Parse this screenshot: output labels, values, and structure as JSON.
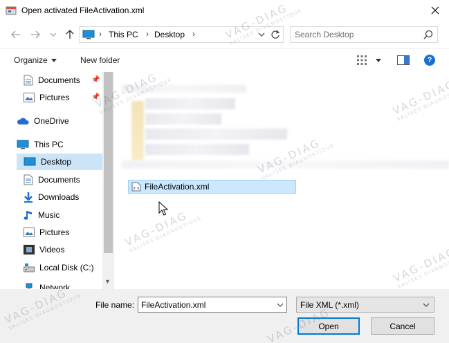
{
  "window": {
    "title": "Open activated FileActivation.xml",
    "close_label": "✕"
  },
  "navigation": {
    "back_label": "←",
    "forward_label": "→",
    "recent_label": "⌄",
    "up_label": "↑"
  },
  "address": {
    "crumbs": [
      "This PC",
      "Desktop"
    ],
    "separator": "›"
  },
  "search": {
    "placeholder": "Search Desktop"
  },
  "toolbar": {
    "organize_label": "Organize",
    "new_folder_label": "New folder",
    "help_label": "?"
  },
  "nav_pane": {
    "quick_access": [
      {
        "label": "Documents",
        "icon": "documents-icon",
        "pinned": true
      },
      {
        "label": "Pictures",
        "icon": "pictures-icon",
        "pinned": true
      }
    ],
    "onedrive_label": "OneDrive",
    "this_pc_label": "This PC",
    "this_pc_items": [
      {
        "label": "Desktop",
        "icon": "desktop-icon",
        "selected": true
      },
      {
        "label": "Documents",
        "icon": "documents-icon"
      },
      {
        "label": "Downloads",
        "icon": "downloads-icon"
      },
      {
        "label": "Music",
        "icon": "music-icon"
      },
      {
        "label": "Pictures",
        "icon": "pictures-icon"
      },
      {
        "label": "Videos",
        "icon": "videos-icon"
      },
      {
        "label": "Local Disk (C:)",
        "icon": "drive-icon"
      }
    ],
    "network_label": "Network"
  },
  "content": {
    "selected_file": "FileActivation.xml"
  },
  "footer": {
    "file_name_label": "File name:",
    "file_name_value": "FileActivation.xml",
    "file_type_value": "File XML (*.xml)",
    "open_label": "Open",
    "cancel_label": "Cancel"
  },
  "watermark": {
    "brand": "VAG-DIAG",
    "tagline": "VALISES DIAGNOSTIQUE"
  },
  "colors": {
    "selection_bg": "#cce8ff",
    "selection_border": "#99d1ff",
    "nav_selected_bg": "#cce4f7",
    "accent": "#0078d7",
    "footer_bg": "#f0f0f0"
  }
}
